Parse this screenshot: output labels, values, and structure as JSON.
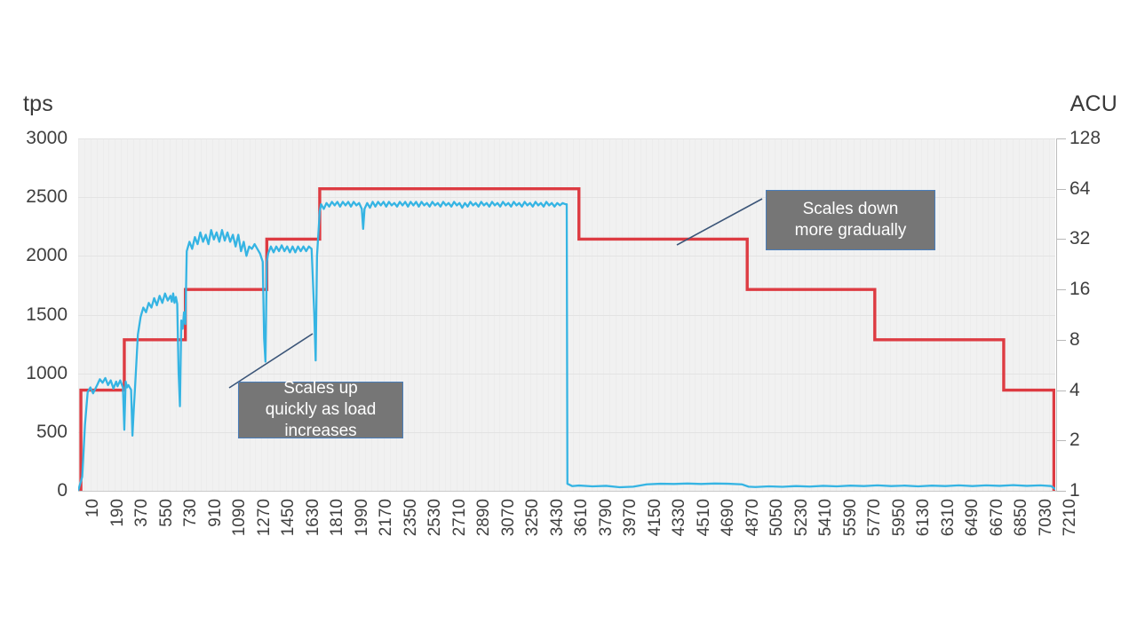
{
  "axes": {
    "left_unit": "tps",
    "right_unit": "ACU",
    "left_ticks": [
      "3000",
      "2500",
      "2000",
      "1500",
      "1000",
      "500",
      "0"
    ],
    "right_ticks": [
      "128",
      "64",
      "32",
      "16",
      "8",
      "4",
      "2",
      "1"
    ],
    "x_ticks": [
      "10",
      "190",
      "370",
      "550",
      "730",
      "910",
      "1090",
      "1270",
      "1450",
      "1630",
      "1810",
      "1990",
      "2170",
      "2350",
      "2530",
      "2710",
      "2890",
      "3070",
      "3250",
      "3430",
      "3610",
      "3790",
      "3970",
      "4150",
      "4330",
      "4510",
      "4690",
      "4870",
      "5050",
      "5230",
      "5410",
      "5590",
      "5770",
      "5950",
      "6130",
      "6310",
      "6490",
      "6670",
      "6850",
      "7030",
      "7210"
    ]
  },
  "annotations": [
    {
      "id": "scale-up",
      "text": "Scales up\nquickly as load\nincreases"
    },
    {
      "id": "scale-down",
      "text": "Scales down\nmore gradually"
    }
  ],
  "colors": {
    "tps_series": "#35b4e3",
    "acu_series": "#dd3b42",
    "plot_background": "#f1f1f1",
    "callout_fill": "#767676",
    "callout_border": "#4a7ebb",
    "leader_line": "#3b5578"
  },
  "chart_data": {
    "type": "line",
    "title": "",
    "xlabel": "",
    "ylabel": "tps",
    "y2label": "ACU",
    "ylim": [
      0,
      3000
    ],
    "y2lim": [
      1,
      128
    ],
    "y2scale": "log2",
    "grid": true,
    "legend": "none",
    "x": [
      10,
      7210
    ],
    "series": [
      {
        "name": "tps",
        "axis": "left",
        "color": "#35b4e3",
        "description": "Throughput in transactions per second. Ramps up in stages with the load, holds a ~2450 tps plateau from ~1850 to ~3610, then drops to near-zero (~30-60 tps) for the remainder of the run.",
        "points": [
          [
            10,
            0
          ],
          [
            40,
            120
          ],
          [
            60,
            560
          ],
          [
            80,
            840
          ],
          [
            100,
            880
          ],
          [
            120,
            830
          ],
          [
            150,
            900
          ],
          [
            170,
            950
          ],
          [
            190,
            920
          ],
          [
            210,
            960
          ],
          [
            230,
            900
          ],
          [
            250,
            940
          ],
          [
            270,
            870
          ],
          [
            290,
            930
          ],
          [
            300,
            890
          ],
          [
            320,
            940
          ],
          [
            340,
            880
          ],
          [
            350,
            520
          ],
          [
            360,
            930
          ],
          [
            370,
            880
          ],
          [
            380,
            900
          ],
          [
            400,
            860
          ],
          [
            410,
            470
          ],
          [
            420,
            700
          ],
          [
            430,
            900
          ],
          [
            450,
            1330
          ],
          [
            470,
            1480
          ],
          [
            490,
            1560
          ],
          [
            510,
            1520
          ],
          [
            530,
            1600
          ],
          [
            550,
            1560
          ],
          [
            570,
            1640
          ],
          [
            590,
            1580
          ],
          [
            610,
            1660
          ],
          [
            630,
            1600
          ],
          [
            650,
            1680
          ],
          [
            670,
            1620
          ],
          [
            690,
            1660
          ],
          [
            700,
            1610
          ],
          [
            710,
            1680
          ],
          [
            720,
            1600
          ],
          [
            730,
            1650
          ],
          [
            740,
            1590
          ],
          [
            750,
            1010
          ],
          [
            760,
            720
          ],
          [
            770,
            1450
          ],
          [
            780,
            1380
          ],
          [
            790,
            1520
          ],
          [
            800,
            1420
          ],
          [
            810,
            2040
          ],
          [
            830,
            2120
          ],
          [
            850,
            2060
          ],
          [
            870,
            2160
          ],
          [
            890,
            2100
          ],
          [
            910,
            2200
          ],
          [
            930,
            2120
          ],
          [
            950,
            2180
          ],
          [
            970,
            2100
          ],
          [
            990,
            2220
          ],
          [
            1010,
            2140
          ],
          [
            1030,
            2200
          ],
          [
            1050,
            2120
          ],
          [
            1070,
            2220
          ],
          [
            1090,
            2130
          ],
          [
            1110,
            2200
          ],
          [
            1130,
            2120
          ],
          [
            1150,
            2180
          ],
          [
            1170,
            2080
          ],
          [
            1190,
            2180
          ],
          [
            1210,
            2040
          ],
          [
            1230,
            2120
          ],
          [
            1250,
            2000
          ],
          [
            1270,
            2080
          ],
          [
            1290,
            2060
          ],
          [
            1310,
            2100
          ],
          [
            1330,
            2060
          ],
          [
            1350,
            2020
          ],
          [
            1370,
            1950
          ],
          [
            1380,
            1300
          ],
          [
            1390,
            1100
          ],
          [
            1400,
            1950
          ],
          [
            1410,
            2020
          ],
          [
            1430,
            2080
          ],
          [
            1450,
            2030
          ],
          [
            1470,
            2080
          ],
          [
            1490,
            2040
          ],
          [
            1510,
            2090
          ],
          [
            1530,
            2040
          ],
          [
            1550,
            2080
          ],
          [
            1570,
            2030
          ],
          [
            1590,
            2080
          ],
          [
            1610,
            2030
          ],
          [
            1630,
            2080
          ],
          [
            1650,
            2040
          ],
          [
            1670,
            2080
          ],
          [
            1690,
            2040
          ],
          [
            1710,
            2080
          ],
          [
            1730,
            2060
          ],
          [
            1750,
            1500
          ],
          [
            1760,
            1110
          ],
          [
            1770,
            2000
          ],
          [
            1790,
            2380
          ],
          [
            1800,
            2440
          ],
          [
            1820,
            2400
          ],
          [
            1840,
            2450
          ],
          [
            1860,
            2420
          ],
          [
            1880,
            2460
          ],
          [
            1900,
            2430
          ],
          [
            1920,
            2460
          ],
          [
            1940,
            2420
          ],
          [
            1960,
            2460
          ],
          [
            1980,
            2430
          ],
          [
            2000,
            2460
          ],
          [
            2020,
            2420
          ],
          [
            2040,
            2460
          ],
          [
            2060,
            2430
          ],
          [
            2080,
            2450
          ],
          [
            2100,
            2400
          ],
          [
            2110,
            2230
          ],
          [
            2120,
            2400
          ],
          [
            2140,
            2450
          ],
          [
            2160,
            2410
          ],
          [
            2180,
            2460
          ],
          [
            2200,
            2420
          ],
          [
            2220,
            2460
          ],
          [
            2240,
            2430
          ],
          [
            2260,
            2460
          ],
          [
            2280,
            2420
          ],
          [
            2300,
            2460
          ],
          [
            2320,
            2430
          ],
          [
            2340,
            2450
          ],
          [
            2360,
            2420
          ],
          [
            2380,
            2460
          ],
          [
            2400,
            2430
          ],
          [
            2420,
            2460
          ],
          [
            2440,
            2420
          ],
          [
            2460,
            2460
          ],
          [
            2480,
            2430
          ],
          [
            2500,
            2460
          ],
          [
            2520,
            2420
          ],
          [
            2540,
            2460
          ],
          [
            2560,
            2430
          ],
          [
            2580,
            2450
          ],
          [
            2600,
            2420
          ],
          [
            2620,
            2460
          ],
          [
            2640,
            2430
          ],
          [
            2660,
            2450
          ],
          [
            2680,
            2420
          ],
          [
            2700,
            2460
          ],
          [
            2720,
            2430
          ],
          [
            2740,
            2450
          ],
          [
            2760,
            2420
          ],
          [
            2780,
            2460
          ],
          [
            2800,
            2430
          ],
          [
            2820,
            2450
          ],
          [
            2840,
            2410
          ],
          [
            2860,
            2450
          ],
          [
            2880,
            2420
          ],
          [
            2900,
            2460
          ],
          [
            2920,
            2430
          ],
          [
            2940,
            2450
          ],
          [
            2960,
            2420
          ],
          [
            2980,
            2460
          ],
          [
            3000,
            2430
          ],
          [
            3020,
            2450
          ],
          [
            3040,
            2420
          ],
          [
            3060,
            2460
          ],
          [
            3080,
            2430
          ],
          [
            3100,
            2450
          ],
          [
            3120,
            2420
          ],
          [
            3140,
            2460
          ],
          [
            3160,
            2430
          ],
          [
            3180,
            2450
          ],
          [
            3200,
            2420
          ],
          [
            3220,
            2460
          ],
          [
            3240,
            2430
          ],
          [
            3260,
            2450
          ],
          [
            3280,
            2420
          ],
          [
            3300,
            2460
          ],
          [
            3320,
            2430
          ],
          [
            3340,
            2450
          ],
          [
            3360,
            2420
          ],
          [
            3380,
            2460
          ],
          [
            3400,
            2430
          ],
          [
            3420,
            2450
          ],
          [
            3440,
            2420
          ],
          [
            3460,
            2460
          ],
          [
            3480,
            2430
          ],
          [
            3500,
            2450
          ],
          [
            3520,
            2420
          ],
          [
            3540,
            2450
          ],
          [
            3560,
            2430
          ],
          [
            3580,
            2450
          ],
          [
            3600,
            2440
          ],
          [
            3610,
            2440
          ],
          [
            3615,
            60
          ],
          [
            3650,
            40
          ],
          [
            3700,
            45
          ],
          [
            3800,
            38
          ],
          [
            3900,
            42
          ],
          [
            4000,
            30
          ],
          [
            4100,
            35
          ],
          [
            4200,
            55
          ],
          [
            4300,
            60
          ],
          [
            4400,
            58
          ],
          [
            4500,
            62
          ],
          [
            4600,
            58
          ],
          [
            4700,
            62
          ],
          [
            4800,
            60
          ],
          [
            4900,
            55
          ],
          [
            4950,
            35
          ],
          [
            5000,
            32
          ],
          [
            5100,
            38
          ],
          [
            5200,
            34
          ],
          [
            5300,
            40
          ],
          [
            5400,
            36
          ],
          [
            5500,
            42
          ],
          [
            5600,
            38
          ],
          [
            5700,
            44
          ],
          [
            5800,
            40
          ],
          [
            5900,
            46
          ],
          [
            6000,
            40
          ],
          [
            6100,
            44
          ],
          [
            6200,
            38
          ],
          [
            6300,
            44
          ],
          [
            6400,
            40
          ],
          [
            6500,
            46
          ],
          [
            6600,
            40
          ],
          [
            6700,
            46
          ],
          [
            6800,
            42
          ],
          [
            6900,
            48
          ],
          [
            7000,
            42
          ],
          [
            7100,
            46
          ],
          [
            7180,
            40
          ],
          [
            7210,
            15
          ]
        ]
      },
      {
        "name": "ACU",
        "axis": "right",
        "color": "#dd3b42",
        "step": true,
        "description": "Aurora Capacity Units. Steps up quickly from 1 to 64 as load is applied, then steps down gradually 64 -> 32 -> 16 -> 8 -> 4 -> 1 after load stops.",
        "steps": [
          {
            "x_start": 10,
            "x_end": 30,
            "acu": 1
          },
          {
            "x_start": 30,
            "x_end": 350,
            "acu": 4
          },
          {
            "x_start": 350,
            "x_end": 800,
            "acu": 8
          },
          {
            "x_start": 800,
            "x_end": 1400,
            "acu": 16
          },
          {
            "x_start": 1400,
            "x_end": 1790,
            "acu": 32
          },
          {
            "x_start": 1790,
            "x_end": 3700,
            "acu": 64
          },
          {
            "x_start": 3700,
            "x_end": 4940,
            "acu": 32
          },
          {
            "x_start": 4940,
            "x_end": 5880,
            "acu": 16
          },
          {
            "x_start": 5880,
            "x_end": 6830,
            "acu": 8
          },
          {
            "x_start": 6830,
            "x_end": 7200,
            "acu": 4
          },
          {
            "x_start": 7200,
            "x_end": 7210,
            "acu": 1
          }
        ]
      }
    ]
  }
}
